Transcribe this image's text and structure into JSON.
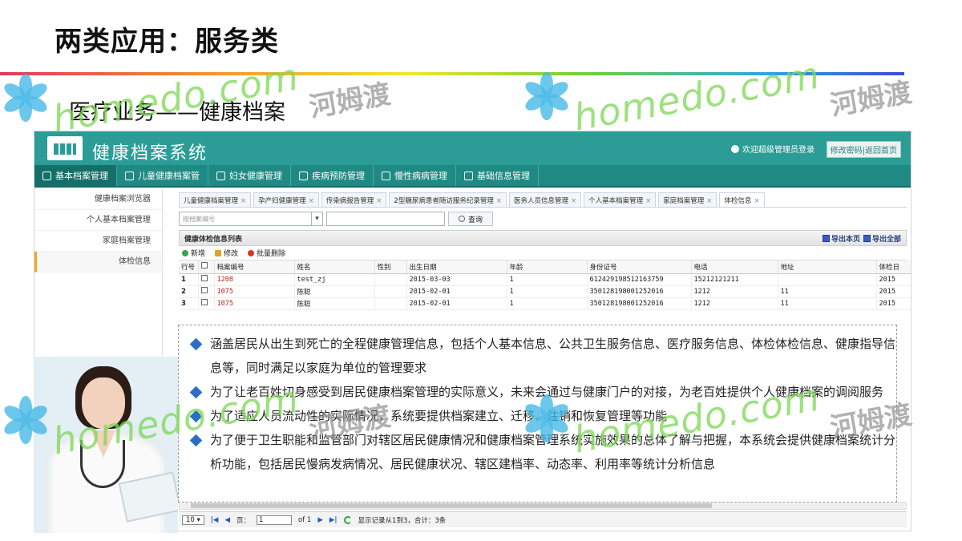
{
  "slide": {
    "title": "两类应用：服务类",
    "subtitle": "医疗业务——健康档案"
  },
  "watermark": {
    "text": "homedo.com",
    "cn": "河姆渡"
  },
  "app": {
    "title": "健康档案系统",
    "welcome": "欢迎超级管理员登录",
    "change_password": "修改密码",
    "back_home": "返回首页",
    "nav": [
      {
        "label": "基本档案管理"
      },
      {
        "label": "儿童健康档案管"
      },
      {
        "label": "妇女健康管理"
      },
      {
        "label": "疾病预防管理"
      },
      {
        "label": "慢性病病管理"
      },
      {
        "label": "基础信息管理"
      }
    ],
    "sidebar": [
      {
        "label": "健康档案浏览器"
      },
      {
        "label": "个人基本档案管理"
      },
      {
        "label": "家庭档案管理"
      },
      {
        "label": "体检信息"
      }
    ],
    "tabs": [
      {
        "label": "儿童健康档案管理"
      },
      {
        "label": "孕产妇健康管理"
      },
      {
        "label": "传染病报告管理"
      },
      {
        "label": "2型糖尿病患者随访服务纪录管理"
      },
      {
        "label": "医务人员信息管理"
      },
      {
        "label": "个人基本档案管理"
      },
      {
        "label": "家庭档案管理"
      },
      {
        "label": "体检信息"
      }
    ],
    "search": {
      "select_placeholder": "按档案编号",
      "query_button": "查询"
    },
    "list_title": "健康体检信息列表",
    "export_page": "导出本页",
    "export_all": "导出全部",
    "toolbar": {
      "add": "新增",
      "edit": "修改",
      "batch_delete": "批量删除"
    },
    "table": {
      "columns": [
        "行号",
        "",
        "档案编号",
        "姓名",
        "性别",
        "出生日期",
        "年龄",
        "身份证号",
        "电话",
        "地址",
        "体检日"
      ],
      "rows": [
        {
          "no": "1",
          "id": "1208",
          "name": "test_zj",
          "gender": "",
          "birth": "2015-03-03",
          "age": "1",
          "idcard": "612429198512163759",
          "phone": "15212121211",
          "addr": "",
          "exam": "2015"
        },
        {
          "no": "2",
          "id": "1075",
          "name": "陈聪",
          "gender": "",
          "birth": "2015-02-01",
          "age": "1",
          "idcard": "350128198001252016",
          "phone": "1212",
          "addr": "11",
          "exam": "2015"
        },
        {
          "no": "3",
          "id": "1075",
          "name": "陈聪",
          "gender": "",
          "birth": "2015-02-01",
          "age": "1",
          "idcard": "350128198001252016",
          "phone": "1212",
          "addr": "11",
          "exam": "2015"
        }
      ]
    },
    "pager": {
      "page_size": "10",
      "page_label": "页：",
      "page_value": "1",
      "of_label": "of 1",
      "summary": "显示记录从1到3，合计：3条"
    }
  },
  "bullets": [
    {
      "text": "涵盖居民从出生到死亡的全程健康管理信息，包括个人基本信息、公共卫生服务信息、医疗服务信息、体检体检信息、健康指导信息等，同时满足以家庭为单位的管理要求"
    },
    {
      "text": "为了让老百姓切身感受到居民健康档案管理的实际意义，未来会通过与健康门户的对接，为老百姓提供个人健康档案的调阅服务"
    },
    {
      "text": "为了适应人员流动性的实际情况，系统要提供档案建立、迁移、注销和恢复管理等功能"
    },
    {
      "text": "为了便于卫生职能和监管部门对辖区居民健康情况和健康档案管理系统实施效果的总体了解与把握，本系统会提供健康档案统计分析功能，包括居民慢病发病情况、居民健康状况、辖区建档率、动态率、利用率等统计分析信息"
    }
  ]
}
